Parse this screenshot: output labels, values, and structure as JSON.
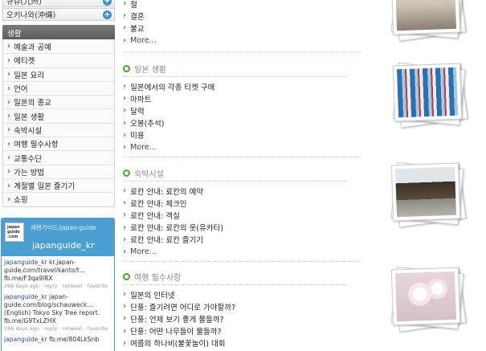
{
  "sidebar": {
    "regions": [
      {
        "label": "규슈(九州)"
      },
      {
        "label": "오키나와(沖縄)"
      }
    ],
    "section_title": "생활",
    "items": [
      {
        "label": "예술과 공예"
      },
      {
        "label": "에티켓"
      },
      {
        "label": "일본 요리"
      },
      {
        "label": "언어"
      },
      {
        "label": "일본의 종교"
      },
      {
        "label": "일본 생활"
      },
      {
        "label": "숙박시설"
      },
      {
        "label": "여행 필수사항"
      },
      {
        "label": "교통수단"
      },
      {
        "label": "가는 방법"
      },
      {
        "label": "계절별 일본 즐기기"
      },
      {
        "label": "쇼핑"
      }
    ]
  },
  "twitter": {
    "avatar_text": "japan guide .com",
    "handle_line": "재팬가이드/japan-guide",
    "name": "japanguide_kr",
    "tweets": [
      {
        "user": "japanguide_kr",
        "text": " kr.japan-guide.com/travel/kanto/t... fb.me/F3qa9lRX",
        "meta": "266 days ago · reply · retweet · favorite"
      },
      {
        "user": "japanguide_kr",
        "text": " japan-guide.com/blog/schauweck... (English) Tokyo Sky Tree report. fb.me/G9TxLZHX",
        "meta": "266 days ago · reply · retweet · favorite"
      },
      {
        "user": "japanguide_kr",
        "text": " fb.me/804LkSnb",
        "meta": ""
      }
    ]
  },
  "main": {
    "top_links": [
      "절",
      "결혼",
      "불교",
      "More..."
    ],
    "sections": [
      {
        "title": "일본 생활",
        "links": [
          "일본에서의 각종 티켓 구매",
          "아파트",
          "달력",
          "오봉(추석)",
          "미용",
          "More..."
        ]
      },
      {
        "title": "숙박시설",
        "links": [
          "료칸 안내: 료칸의 예약",
          "료칸 안내: 체크인",
          "료칸 안내: 객실",
          "료칸 안내: 료칸의 옷(유카타)",
          "료칸 안내: 료칸 즐기기",
          "More..."
        ]
      },
      {
        "title": "여행 필수사항",
        "links": [
          "일본의 인터넷",
          "단풍: 즐기려면 어디로 가야할까?",
          "단풍: 언제 보기 좋게 물들까?",
          "단풍: 어떤 나무들이 물들까?",
          "여름의 하나비(불꽃놀이) 대회"
        ]
      }
    ]
  },
  "colors": {
    "accent_green": "#4aa52d",
    "twitter_blue": "#4a9fd0",
    "header_gray": "#666666"
  }
}
